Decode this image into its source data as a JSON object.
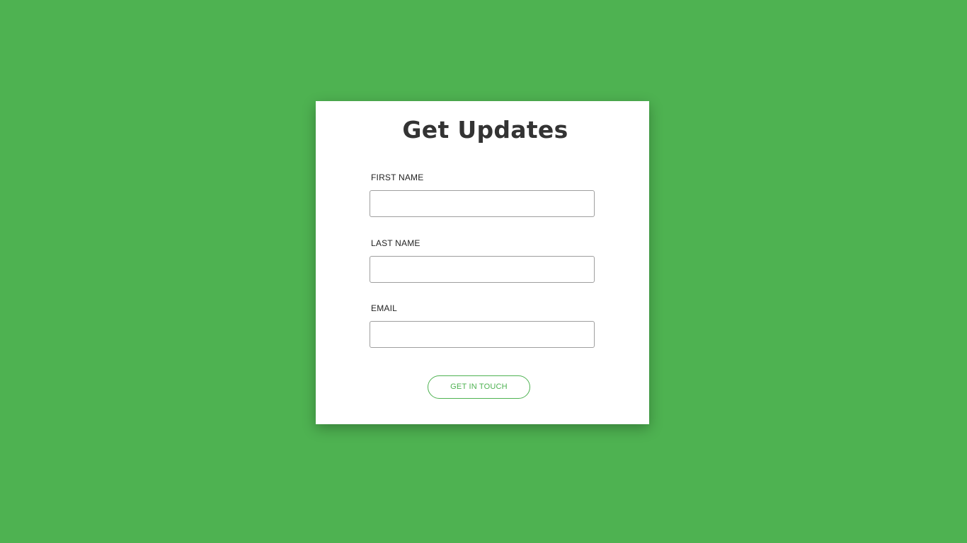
{
  "colors": {
    "background": "#4eb251",
    "card": "#ffffff",
    "title": "#333333",
    "accent": "#4eb251",
    "input_border": "#9e9e9e"
  },
  "form": {
    "title": "Get Updates",
    "fields": [
      {
        "label": "FIRST NAME",
        "value": "",
        "placeholder": ""
      },
      {
        "label": "LAST NAME",
        "value": "",
        "placeholder": ""
      },
      {
        "label": "EMAIL",
        "value": "",
        "placeholder": ""
      }
    ],
    "submit_label": "GET IN TOUCH"
  }
}
